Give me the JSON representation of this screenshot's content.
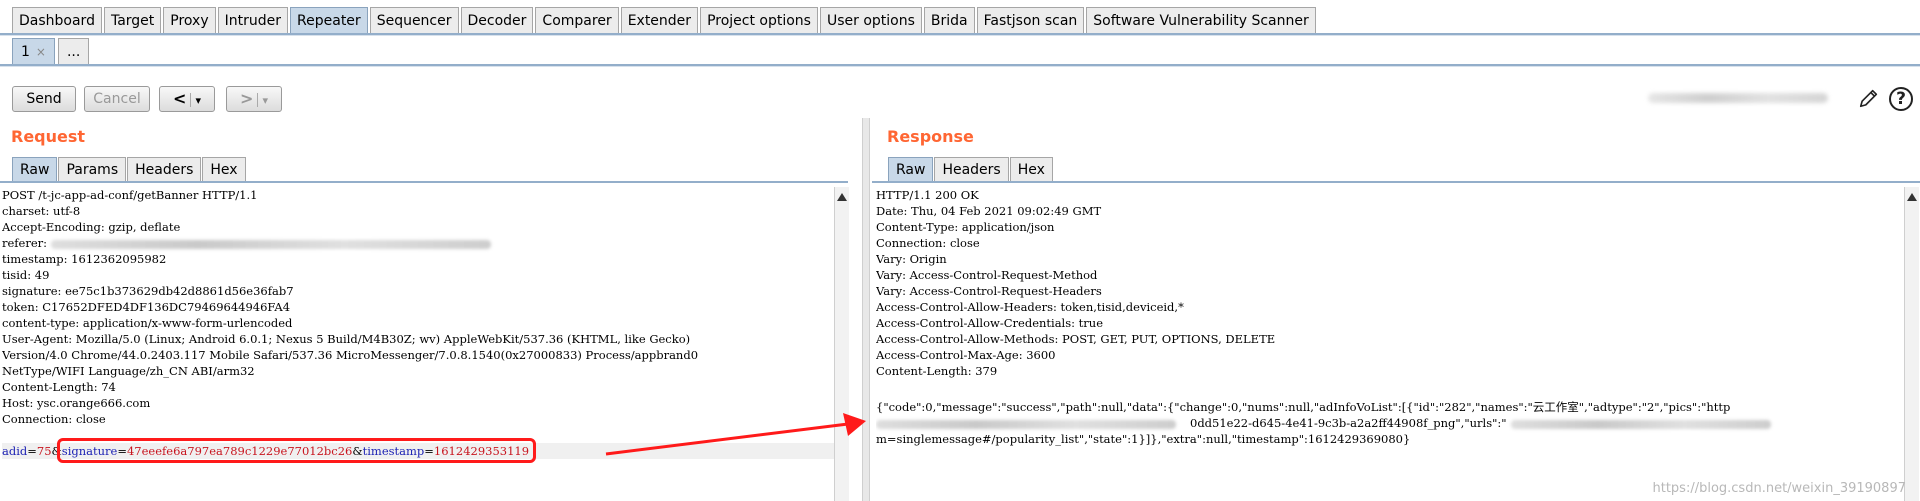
{
  "top_tabs": [
    "Dashboard",
    "Target",
    "Proxy",
    "Intruder",
    "Repeater",
    "Sequencer",
    "Decoder",
    "Comparer",
    "Extender",
    "Project options",
    "User options",
    "Brida",
    "Fastjson scan",
    "Software Vulnerability Scanner"
  ],
  "active_top_tab": "Repeater",
  "sub_tabs": {
    "first": "1",
    "first_close": "×",
    "more": "..."
  },
  "toolbar": {
    "send": "Send",
    "cancel": "Cancel",
    "back": "<",
    "forward": ">",
    "dropdown": "▾",
    "help": "?"
  },
  "request": {
    "title": "Request",
    "tabs": [
      "Raw",
      "Params",
      "Headers",
      "Hex"
    ],
    "lines": [
      "POST /t-jc-app-ad-conf/getBanner HTTP/1.1",
      "charset: utf-8",
      "Accept-Encoding: gzip, deflate",
      "referer: ",
      "timestamp: 1612362095982",
      "tisid: 49",
      "signature: ee75c1b373629db42d8861d56e36fab7",
      "token: C17652DFED4DF136DC79469644946FA4",
      "content-type: application/x-www-form-urlencoded",
      "User-Agent: Mozilla/5.0 (Linux; Android 6.0.1; Nexus 5 Build/M4B30Z; wv) AppleWebKit/537.36 (KHTML, like Gecko)",
      "Version/4.0 Chrome/44.0.2403.117 Mobile Safari/537.36 MicroMessenger/7.0.8.1540(0x27000833) Process/appbrand0",
      "NetType/WIFI Language/zh_CN ABI/arm32",
      "Content-Length: 74",
      "Host: ysc.orange666.com",
      "Connection: close"
    ],
    "body": {
      "p1_name": "adid",
      "p1_eq": "=",
      "p1_val": "75",
      "amp1": "&",
      "p2_name": "signature",
      "p2_eq": "=",
      "p2_val": "47eeefe6a797ea789c1229e77012bc26",
      "amp2": "&",
      "p3_name": "timestamp",
      "p3_eq": "=",
      "p3_val": "1612429353119"
    }
  },
  "response": {
    "title": "Response",
    "tabs": [
      "Raw",
      "Headers",
      "Hex"
    ],
    "lines": [
      "HTTP/1.1 200 OK",
      "Date: Thu, 04 Feb 2021 09:02:49 GMT",
      "Content-Type: application/json",
      "Connection: close",
      "Vary: Origin",
      "Vary: Access-Control-Request-Method",
      "Vary: Access-Control-Request-Headers",
      "Access-Control-Allow-Headers: token,tisid,deviceid,*",
      "Access-Control-Allow-Credentials: true",
      "Access-Control-Allow-Methods: POST, GET, PUT, OPTIONS, DELETE",
      "Access-Control-Max-Age: 3600",
      "Content-Length: 379"
    ],
    "body1": "{\"code\":0,\"message\":\"success\",\"path\":null,\"data\":{\"change\":0,\"nums\":null,\"adInfoVoList\":[{\"id\":\"282\",\"names\":\"云工作室\",\"adtype\":\"2\",\"pics\":\"http",
    "body2": "0dd51e22-d645-4e41-9c3b-a2a2ff44908f_png\",\"urls\":\"",
    "body3": "m=singlemessage#/popularity_list\",\"state\":1}]},\"extra\":null,\"timestamp\":1612429369080}"
  },
  "watermark": "https://blog.csdn.net/weixin_39190897",
  "colors": {
    "accent_title": "#ff6633",
    "active_tab": "#c8d8e8",
    "highlight": "#ff1a1a",
    "param_name": "#1e23b4",
    "param_value": "#c8141e"
  }
}
